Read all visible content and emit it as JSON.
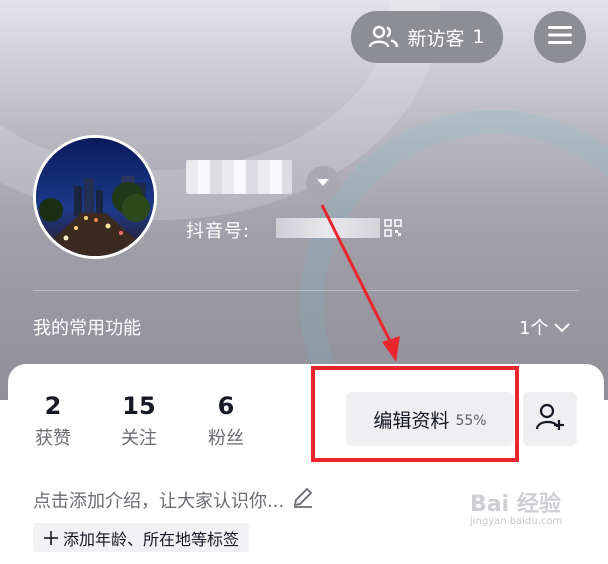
{
  "header": {
    "visitor_label": "新访客",
    "visitor_count": "1",
    "icons": [
      "people-icon",
      "hamburger-menu-icon",
      "dropdown-chevron-icon",
      "qr-code-icon"
    ]
  },
  "profile": {
    "id_label": "抖音号:"
  },
  "functions": {
    "title": "我的常用功能",
    "count": "1个"
  },
  "stats": [
    {
      "value": "2",
      "label": "获赞"
    },
    {
      "value": "15",
      "label": "关注"
    },
    {
      "value": "6",
      "label": "粉丝"
    }
  ],
  "actions": {
    "edit_label": "编辑资料",
    "edit_percent": "55%"
  },
  "bio": {
    "placeholder": "点击添加介绍，让大家认识你...",
    "tag_label": "添加年龄、所在地等标签"
  },
  "watermark": {
    "main": "Bai 经验",
    "sub": "jingyan.baidu.com"
  },
  "colors": {
    "highlight": "#e8262c",
    "header_gradient_top": "#e3e3e9",
    "header_gradient_bottom": "#8f8e99"
  }
}
